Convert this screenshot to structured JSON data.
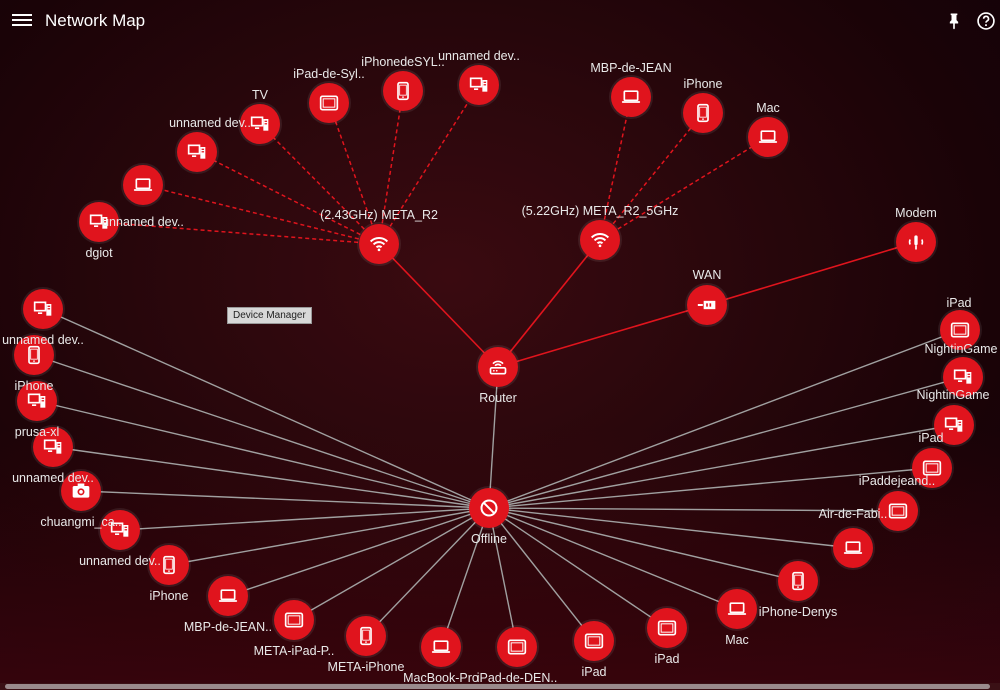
{
  "header": {
    "title": "Network Map",
    "menu_icon": "menu-icon",
    "pin_icon": "pin-icon",
    "help_icon": "help-icon"
  },
  "tooltip": "Device Manager",
  "colors": {
    "node": "#e0141d",
    "wired_link": "#a0a0a0",
    "wifi_link": "#e0141d",
    "background": "#2a070c"
  },
  "hubs": {
    "router": {
      "label": "Router",
      "icon": "router-icon"
    },
    "offline": {
      "label": "Offline",
      "icon": "blocked-icon"
    },
    "wan": {
      "label": "WAN",
      "icon": "ethernet-icon"
    },
    "modem": {
      "label": "Modem",
      "icon": "modem-icon"
    },
    "ap24": {
      "label": "(2.43GHz) META_R2",
      "icon": "wifi-icon"
    },
    "ap5": {
      "label": "(5.22GHz) META_R2_5GHz",
      "icon": "wifi-icon"
    }
  },
  "ap24_devices": [
    {
      "label": "dgiot",
      "icon": "desktop-icon"
    },
    {
      "label": "unnamed dev..",
      "icon": "laptop-icon"
    },
    {
      "label": "unnamed dev..",
      "icon": "desktop-icon"
    },
    {
      "label": "TV",
      "icon": "desktop-icon"
    },
    {
      "label": "iPad-de-Syl..",
      "icon": "tablet-icon"
    },
    {
      "label": "iPhonedeSYL..",
      "icon": "phone-icon"
    },
    {
      "label": "unnamed dev..",
      "icon": "desktop-icon"
    }
  ],
  "ap5_devices": [
    {
      "label": "MBP-de-JEAN",
      "icon": "laptop-icon"
    },
    {
      "label": "iPhone",
      "icon": "phone-icon"
    },
    {
      "label": "Mac",
      "icon": "laptop-icon"
    }
  ],
  "offline_devices": [
    {
      "label": "unnamed dev..",
      "icon": "desktop-icon"
    },
    {
      "label": "iPhone",
      "icon": "phone-icon"
    },
    {
      "label": "prusa-xl",
      "icon": "desktop-icon"
    },
    {
      "label": "unnamed dev..",
      "icon": "desktop-icon"
    },
    {
      "label": "chuangmi_ca..",
      "icon": "camera-icon"
    },
    {
      "label": "unnamed dev..",
      "icon": "desktop-icon"
    },
    {
      "label": "iPhone",
      "icon": "phone-icon"
    },
    {
      "label": "MBP-de-JEAN..",
      "icon": "laptop-icon"
    },
    {
      "label": "META-iPad-P..",
      "icon": "tablet-icon"
    },
    {
      "label": "META-iPhone",
      "icon": "phone-icon"
    },
    {
      "label": "MacBook-Pro",
      "icon": "laptop-icon"
    },
    {
      "label": "iPad-de-DEN..",
      "icon": "tablet-icon"
    },
    {
      "label": "iPad",
      "icon": "tablet-icon"
    },
    {
      "label": "iPad",
      "icon": "tablet-icon"
    },
    {
      "label": "Mac",
      "icon": "laptop-icon"
    },
    {
      "label": "iPhone-Denys",
      "icon": "phone-icon"
    },
    {
      "label": "",
      "icon": "laptop-icon"
    },
    {
      "label": "Air-de-Fabi..",
      "icon": "tablet-icon"
    },
    {
      "label": "iPaddejeand..",
      "icon": "tablet-icon"
    },
    {
      "label": "iPad",
      "icon": "desktop-icon"
    },
    {
      "label": "NightinGame",
      "icon": "desktop-icon"
    },
    {
      "label": "NightinGame",
      "icon": "tablet-icon"
    },
    {
      "label": "iPad",
      "icon": ""
    }
  ]
}
